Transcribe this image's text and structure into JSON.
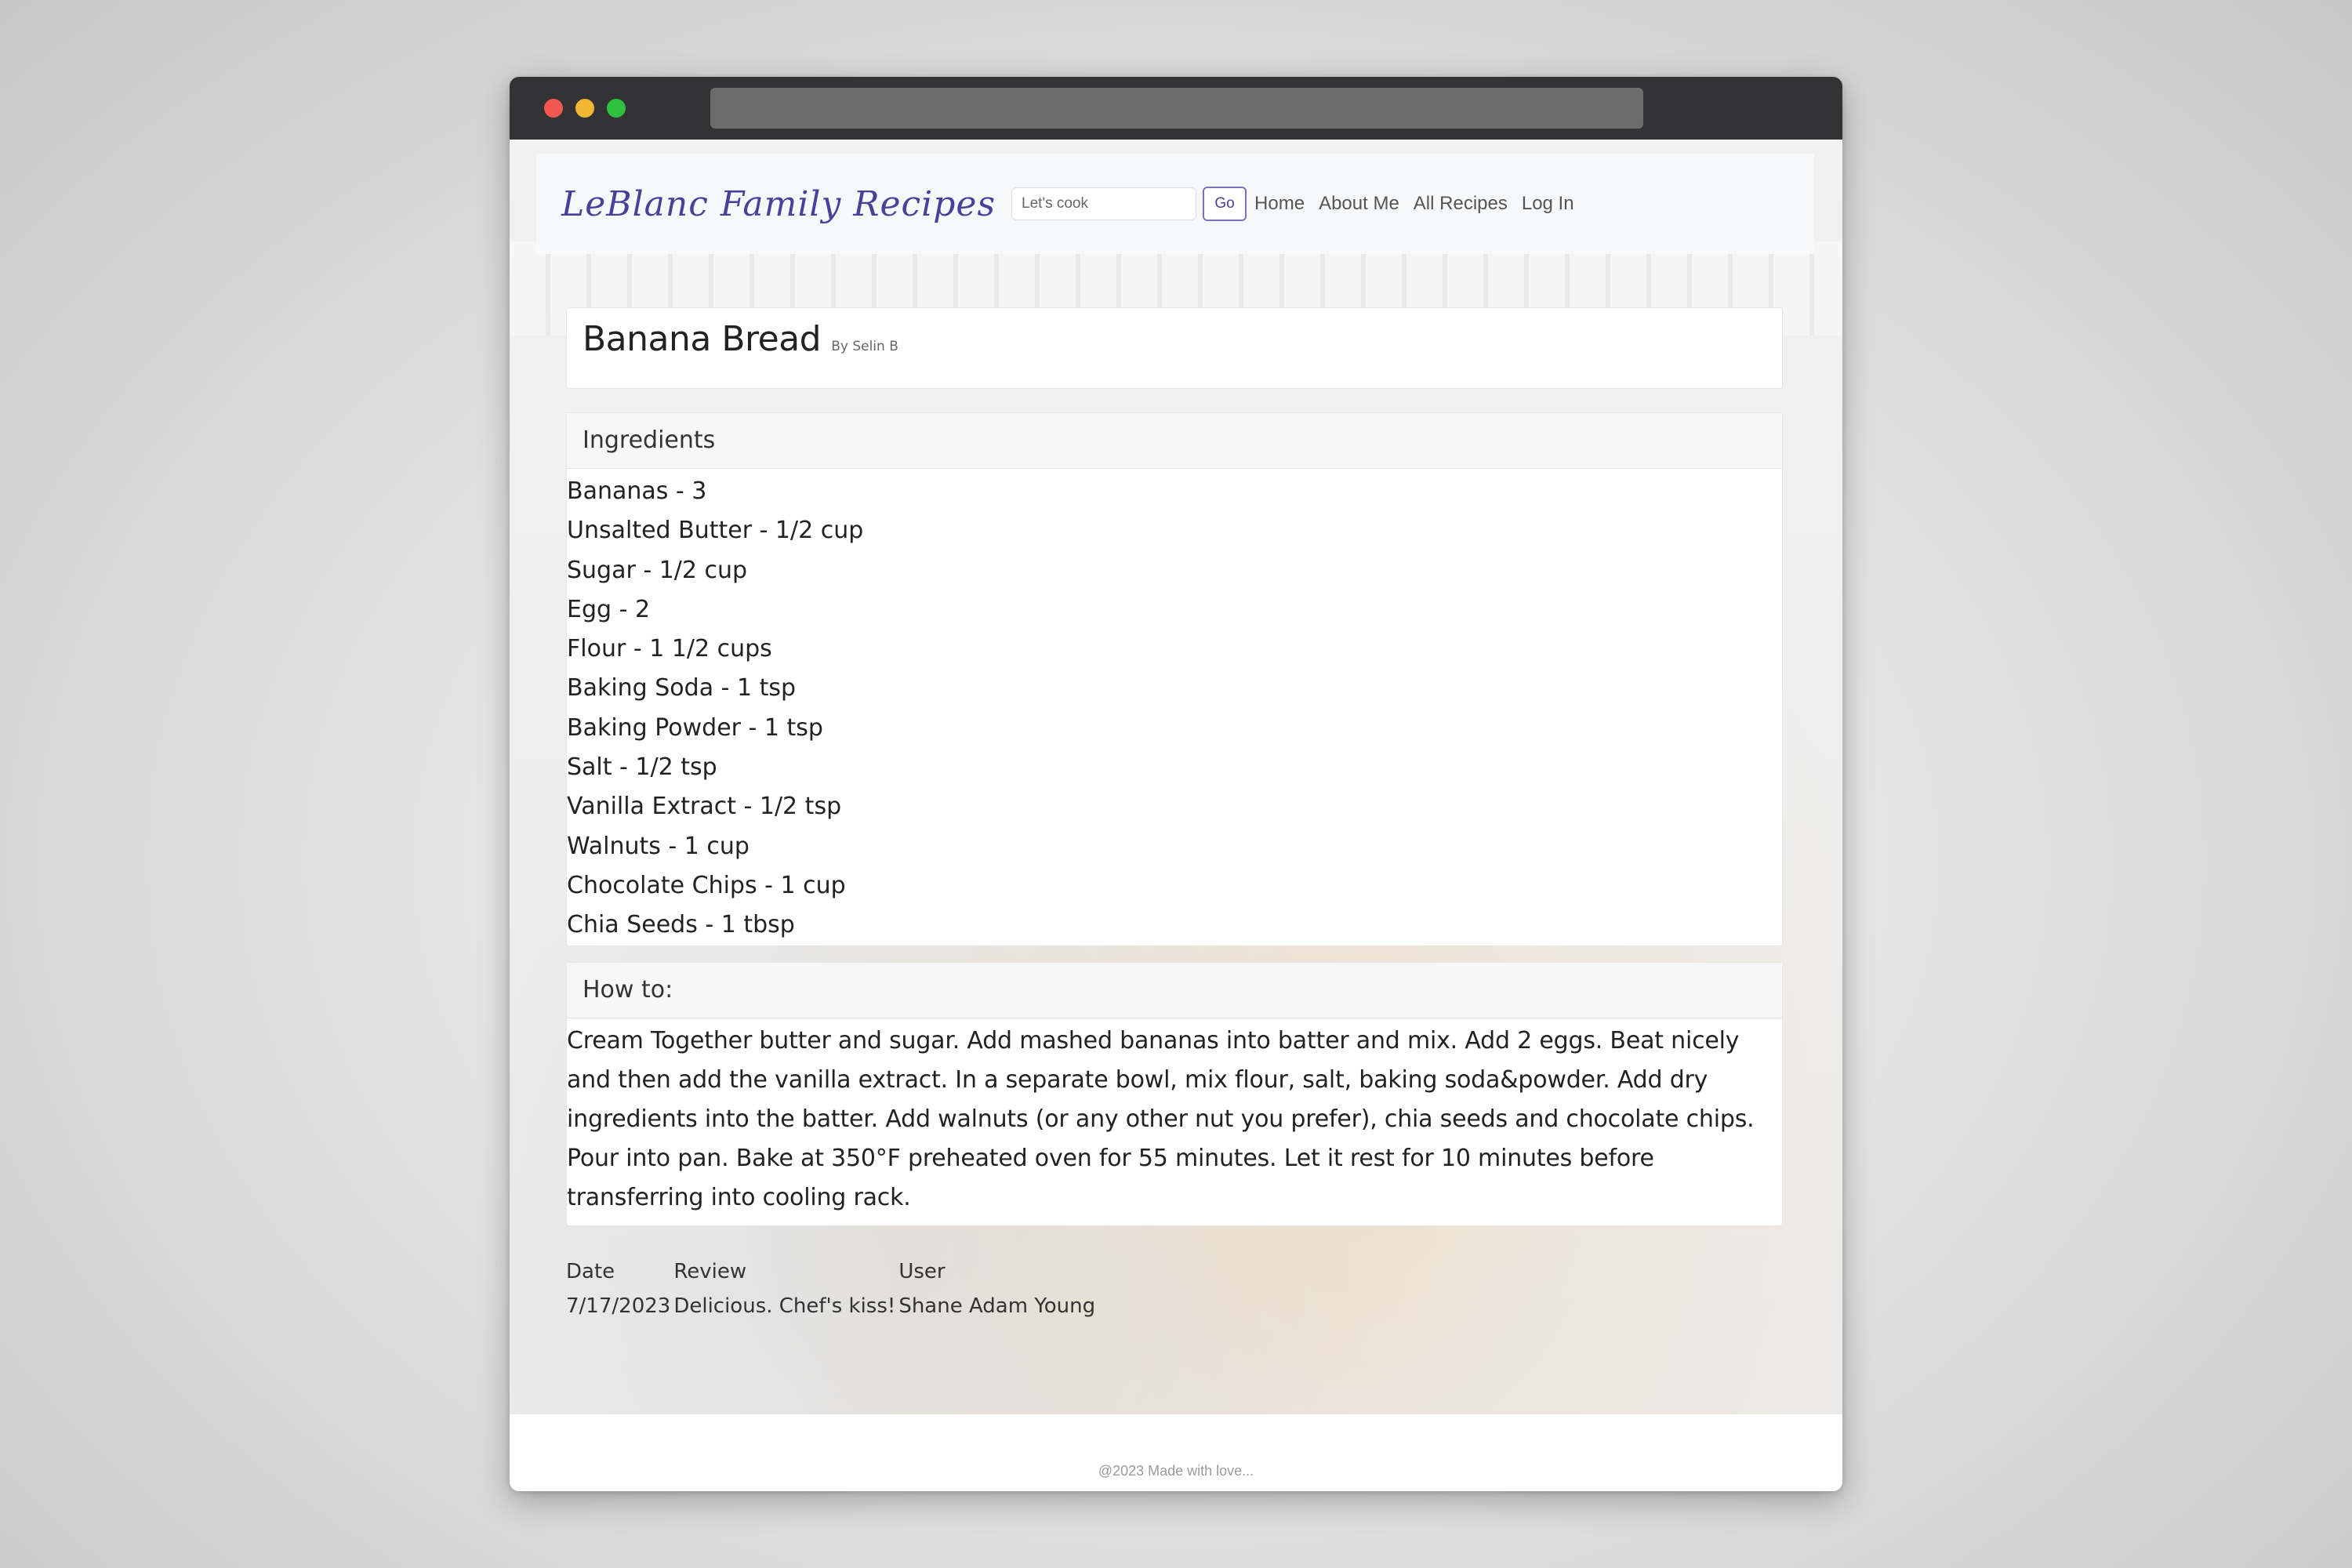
{
  "navbar": {
    "brand": "LeBlanc Family Recipes",
    "search_placeholder": "Let's cook",
    "go_label": "Go",
    "links": [
      "Home",
      "About Me",
      "All Recipes",
      "Log In"
    ]
  },
  "recipe": {
    "title": "Banana Bread",
    "author": "By Selin B"
  },
  "ingredients": {
    "header": "Ingredients",
    "items": [
      "Bananas - 3",
      "Unsalted Butter - 1/2 cup",
      "Sugar - 1/2 cup",
      "Egg - 2",
      "Flour - 1 1/2 cups",
      "Baking Soda - 1 tsp",
      "Baking Powder - 1 tsp",
      "Salt - 1/2 tsp",
      "Vanilla Extract - 1/2 tsp",
      "Walnuts - 1 cup",
      "Chocolate Chips - 1 cup",
      "Chia Seeds - 1 tbsp"
    ]
  },
  "howto": {
    "header": "How to:",
    "text": "Cream Together butter and sugar. Add mashed bananas into batter and mix. Add 2 eggs. Beat nicely and then add the vanilla extract. In a separate bowl, mix flour, salt, baking soda&powder. Add dry ingredients into the batter. Add walnuts (or any other nut you prefer), chia seeds and chocolate chips. Pour into pan. Bake at 350°F preheated oven for 55 minutes. Let it rest for 10 minutes before transferring into cooling rack."
  },
  "reviews": {
    "columns": [
      "Date",
      "Review",
      "User"
    ],
    "rows": [
      [
        "7/17/2023",
        "Delicious. Chef's kiss!",
        "Shane Adam Young"
      ]
    ]
  },
  "footer": {
    "text": "@2023 Made with love..."
  },
  "colors": {
    "brand": "#4a3f9a",
    "titlebar": "#333335"
  }
}
